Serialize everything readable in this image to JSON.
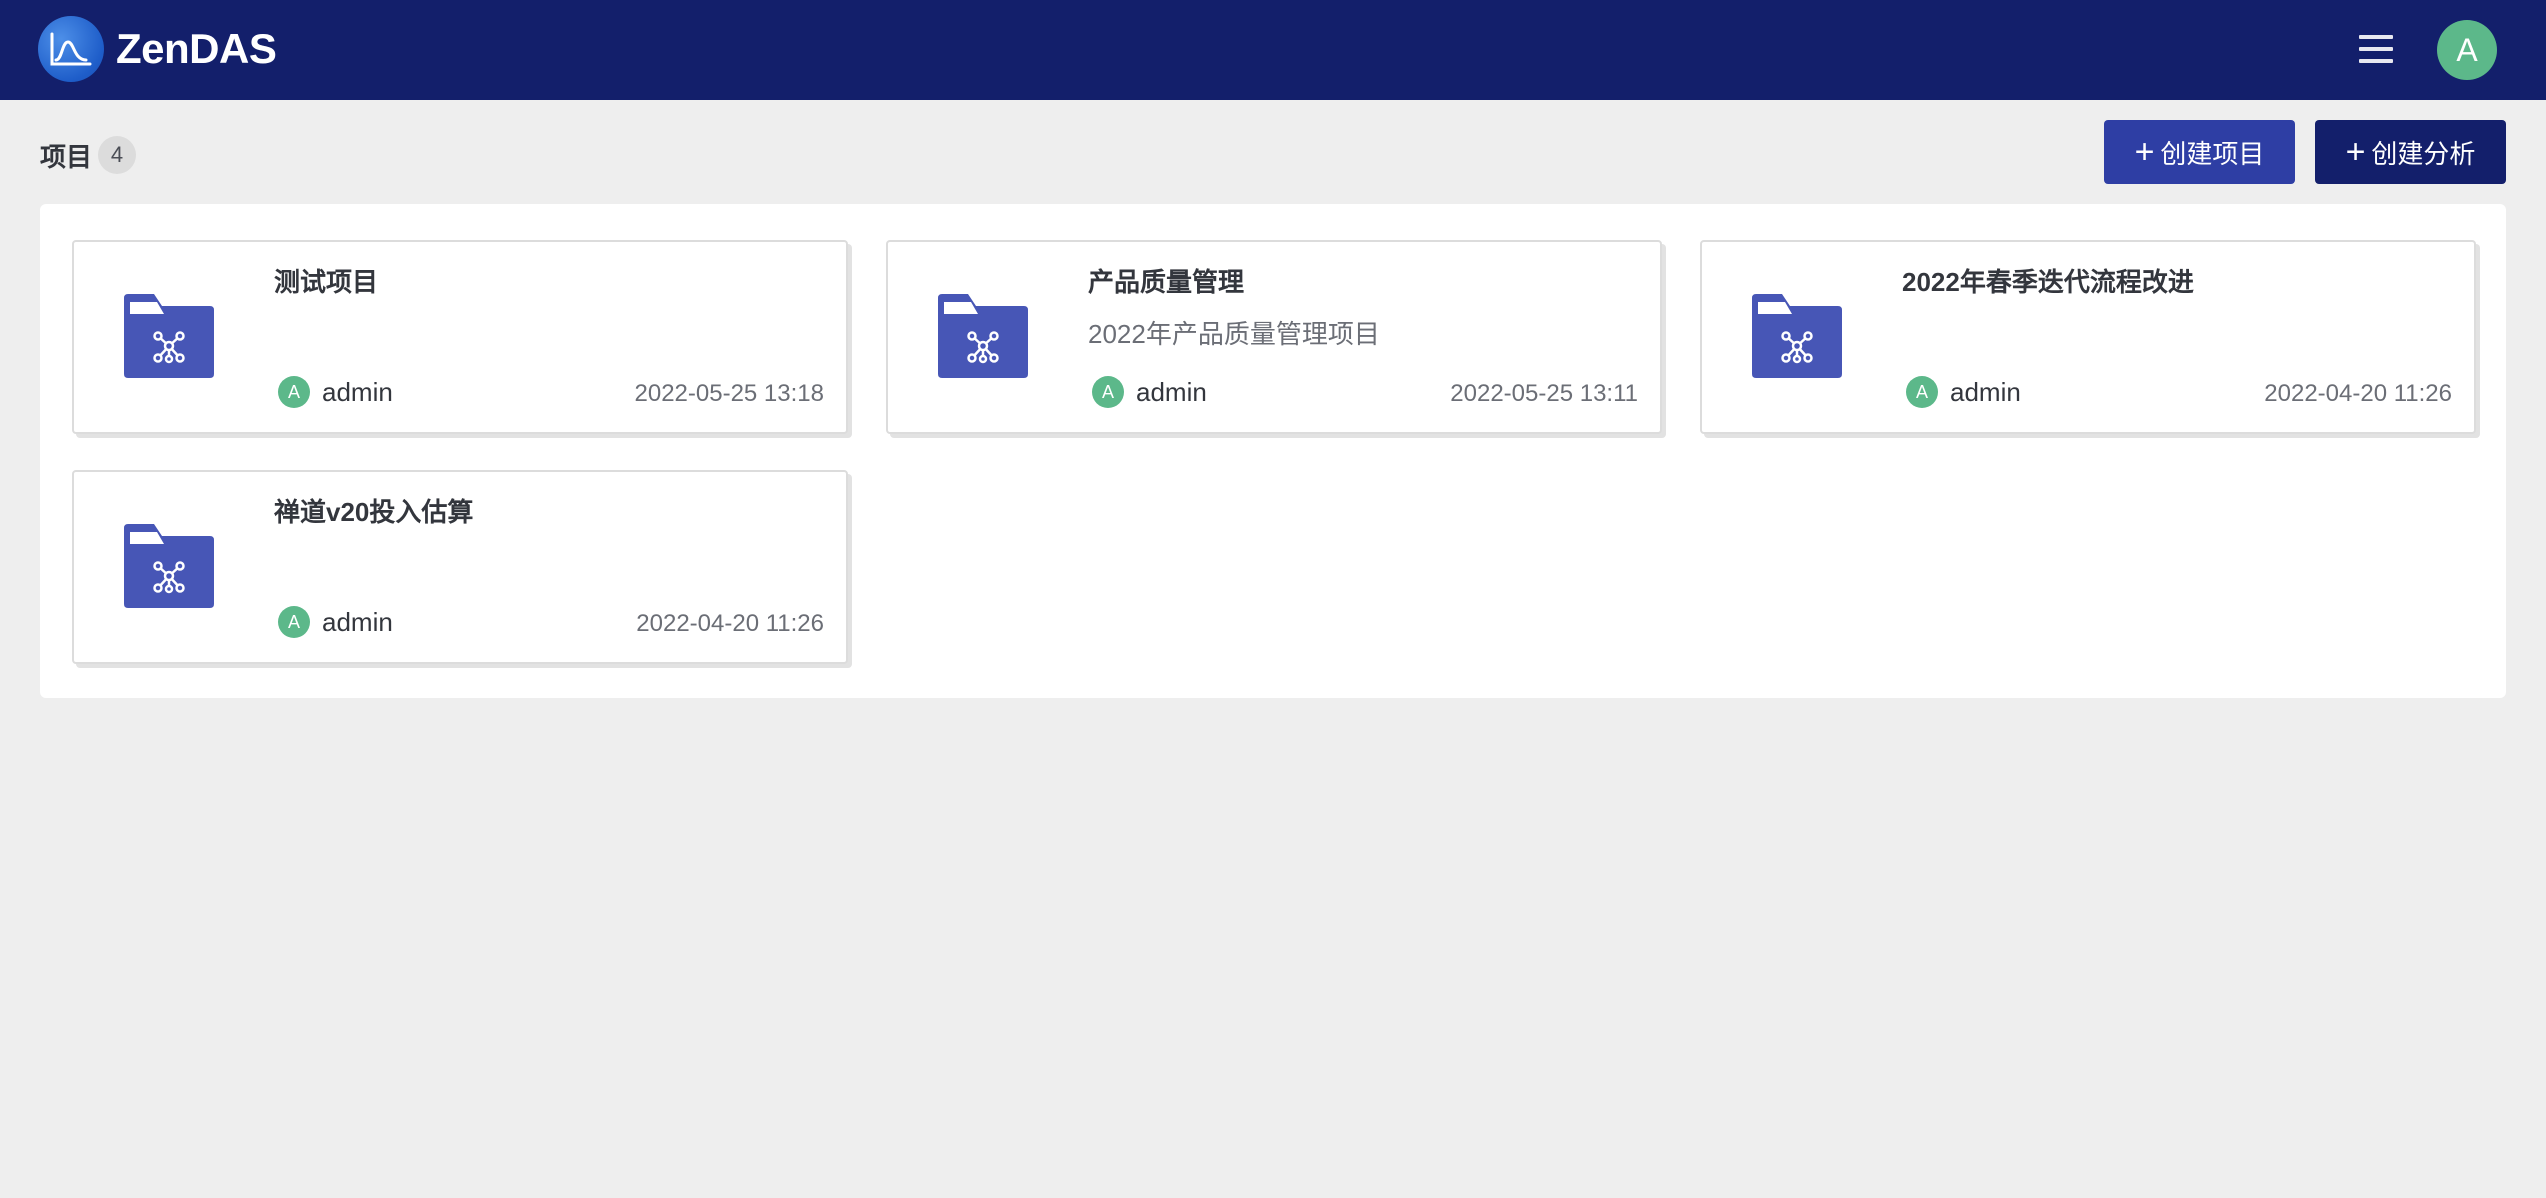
{
  "app": {
    "brand": "ZenDAS",
    "user_initial": "A"
  },
  "header": {
    "section_label": "项目",
    "project_count": "4",
    "create_project_label": "创建项目",
    "create_analysis_label": "创建分析"
  },
  "projects": [
    {
      "title": "测试项目",
      "description": "",
      "owner_initial": "A",
      "owner": "admin",
      "time": "2022-05-25 13:18"
    },
    {
      "title": "产品质量管理",
      "description": "2022年产品质量管理项目",
      "owner_initial": "A",
      "owner": "admin",
      "time": "2022-05-25 13:11"
    },
    {
      "title": "2022年春季迭代流程改进",
      "description": "",
      "owner_initial": "A",
      "owner": "admin",
      "time": "2022-04-20 11:26"
    },
    {
      "title": "禅道v20投入估算",
      "description": "",
      "owner_initial": "A",
      "owner": "admin",
      "time": "2022-04-20 11:26"
    }
  ],
  "icons": {
    "logo": "zendas-logo-icon",
    "menu": "hamburger-menu-icon",
    "plus": "plus-icon",
    "project": "folder-network-icon"
  },
  "colors": {
    "topbar": "#131f6b",
    "primary_button": "#2e3ea4",
    "secondary_button": "#131f6b",
    "folder_icon": "#4756b6",
    "avatar": "#5cb88a"
  }
}
